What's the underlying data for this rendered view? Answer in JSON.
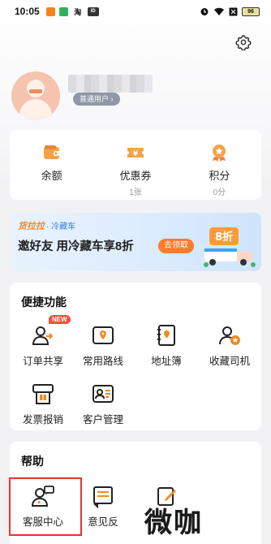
{
  "status_bar": {
    "time": "10:05",
    "app_icons": [
      "orange-app-icon",
      "green-app-icon",
      "taobao-icon",
      "id-card-icon"
    ],
    "battery": "96"
  },
  "profile": {
    "member_level": "普通用户 ›"
  },
  "wallet": {
    "items": [
      {
        "label": "余额",
        "sub": "",
        "icon": "wallet-icon"
      },
      {
        "label": "优惠券",
        "sub": "1张",
        "icon": "coupon-icon"
      },
      {
        "label": "积分",
        "sub": "0分",
        "icon": "points-icon"
      }
    ]
  },
  "banner": {
    "brand": "货拉拉",
    "brand_sub": "· 冷藏车",
    "headline": "邀好友 用冷藏车享8折",
    "cta": "去领取",
    "tag": "8折"
  },
  "quick_functions": {
    "title": "便捷功能",
    "new_badge": "NEW",
    "items": [
      {
        "label": "订单共享",
        "icon": "share-order-icon"
      },
      {
        "label": "常用路线",
        "icon": "route-icon"
      },
      {
        "label": "地址簿",
        "icon": "address-book-icon"
      },
      {
        "label": "收藏司机",
        "icon": "favorite-driver-icon"
      },
      {
        "label": "发票报销",
        "icon": "invoice-icon"
      },
      {
        "label": "客户管理",
        "icon": "customer-icon"
      }
    ]
  },
  "help": {
    "title": "帮助",
    "items": [
      {
        "label": "客服中心",
        "icon": "service-icon"
      },
      {
        "label": "意见反",
        "icon": "feedback-icon"
      },
      {
        "label": "",
        "icon": "edit-icon"
      }
    ]
  },
  "watermark": "微咖",
  "colors": {
    "accent": "#f08a21",
    "orange_cta": "#ff7a2a",
    "highlight": "#e8322b",
    "blue": "#2b7ee6"
  }
}
